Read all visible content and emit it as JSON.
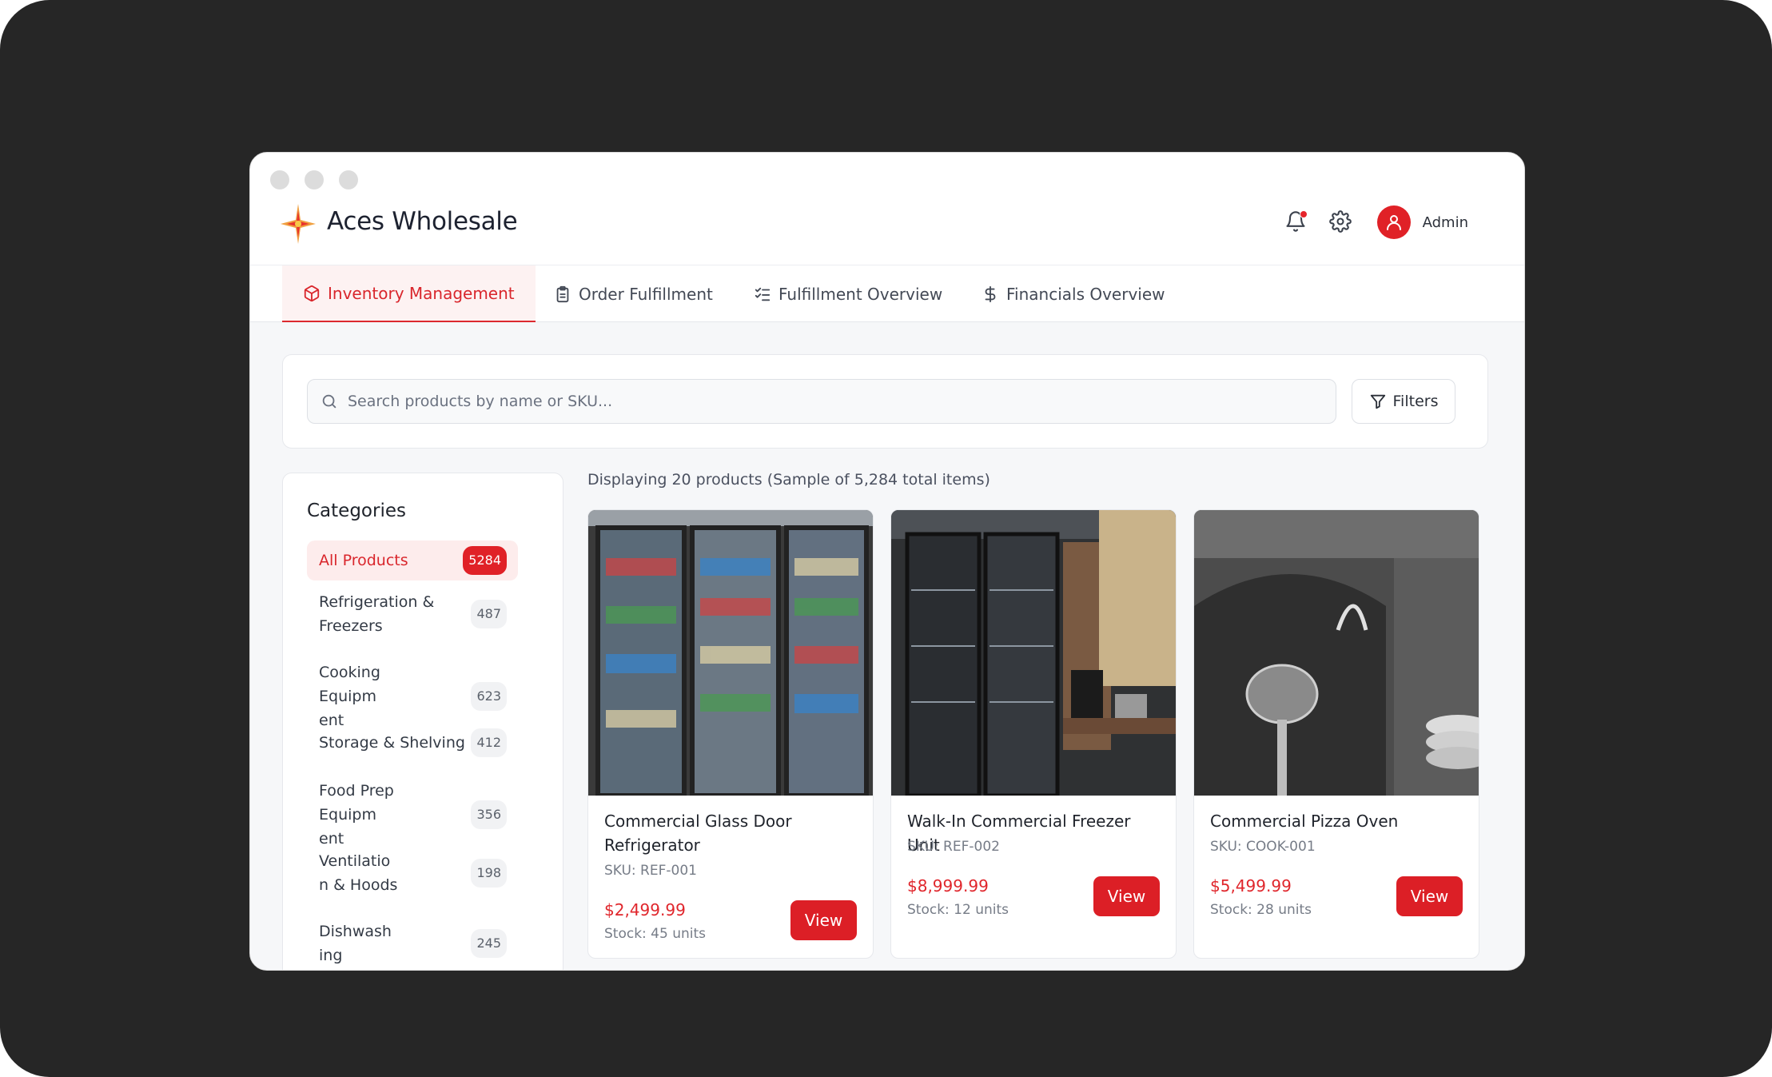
{
  "app": {
    "brand": "Aces Wholesale"
  },
  "header": {
    "user_label": "Admin",
    "notification_dot_color": "#e5242b",
    "accent_color": "#dc1f26"
  },
  "tabs": [
    {
      "label": "Inventory Management",
      "icon": "cube-icon",
      "active": true
    },
    {
      "label": "Order Fulfillment",
      "icon": "clipboard-icon",
      "active": false
    },
    {
      "label": "Fulfillment Overview",
      "icon": "checklist-icon",
      "active": false
    },
    {
      "label": "Financials Overview",
      "icon": "dollar-icon",
      "active": false
    }
  ],
  "search": {
    "placeholder": "Search products by name or SKU...",
    "value": "",
    "filters_label": "Filters"
  },
  "categories": {
    "title": "Categories",
    "items": [
      {
        "label": "All Products",
        "count": "5284",
        "active": true
      },
      {
        "label": "Refrigeration & Freezers",
        "count": "487"
      },
      {
        "label": "Cooking Equipm ent",
        "count": "623"
      },
      {
        "label": "Storage & Shelving",
        "count": "412"
      },
      {
        "label": "Food Prep Equipm ent",
        "count": "356"
      },
      {
        "label": "Ventilation & Hoods",
        "count": "198"
      },
      {
        "label": "Dishwash ing",
        "count": "245"
      }
    ]
  },
  "summary": "Displaying 20 products (Sample of 5,284 total items)",
  "products": [
    {
      "name": "Commercial Glass Door Refrigerator",
      "sku": "SKU: REF-001",
      "price": "$2,499.99",
      "stock": "Stock: 45 units",
      "view_label": "View"
    },
    {
      "name": "Walk-In Commercial Freezer Unit",
      "sku": "SKU: REF-002",
      "price": "$8,999.99",
      "stock": "Stock: 12 units",
      "view_label": "View"
    },
    {
      "name": "Commercial Pizza Oven",
      "sku": "SKU: COOK-001",
      "price": "$5,499.99",
      "stock": "Stock: 28 units",
      "view_label": "View"
    }
  ]
}
